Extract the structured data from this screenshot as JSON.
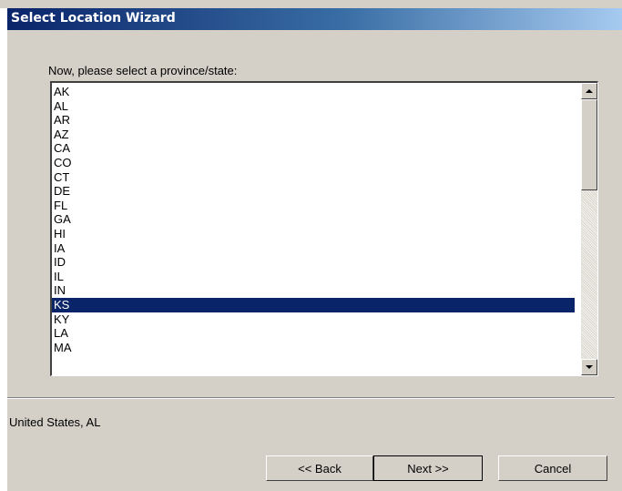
{
  "window": {
    "title": "Select Location Wizard"
  },
  "prompt": "Now, please select a province/state:",
  "list": {
    "items": [
      "AK",
      "AL",
      "AR",
      "AZ",
      "CA",
      "CO",
      "CT",
      "DE",
      "FL",
      "GA",
      "HI",
      "IA",
      "ID",
      "IL",
      "IN",
      "KS",
      "KY",
      "LA",
      "MA"
    ],
    "selected": "KS"
  },
  "status": "United States, AL",
  "buttons": {
    "back": "<< Back",
    "next": "Next >>",
    "cancel": "Cancel"
  },
  "colors": {
    "selection": "#0a246a",
    "dialog_bg": "#d4d0c8"
  }
}
